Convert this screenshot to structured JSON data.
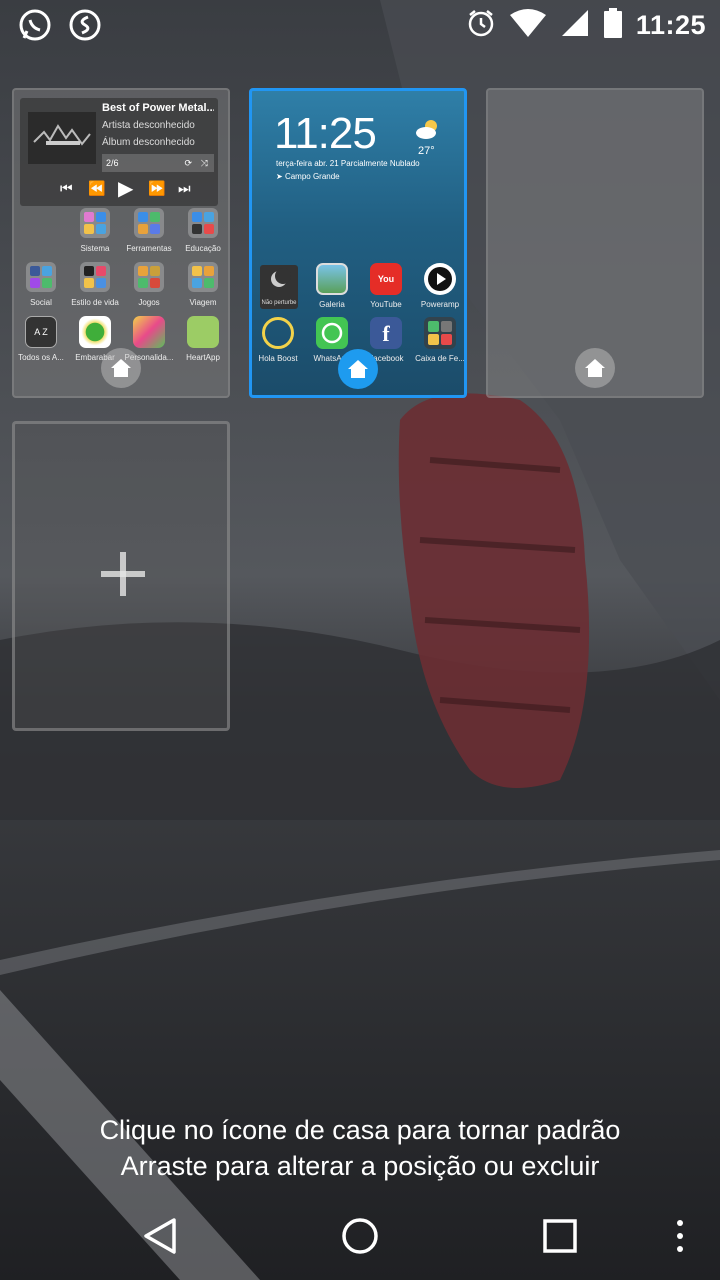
{
  "status_bar": {
    "time": "11:25",
    "left_icons": [
      "whatsapp-icon",
      "shazam-icon"
    ],
    "right_icons": [
      "alarm-icon",
      "wifi-icon",
      "signal-icon",
      "battery-icon"
    ]
  },
  "pages": {
    "left": {
      "music_widget": {
        "title": "Best of Power Metal...",
        "artist": "Artista desconhecido",
        "album": "Álbum desconhecido",
        "track": "2/6"
      },
      "folders_row1": [
        "Sistema",
        "Ferramentas",
        "Educação"
      ],
      "folders_row2": [
        "Social",
        "Estilo de vida",
        "Jogos",
        "Viagem"
      ],
      "apps_row3": [
        "Todos os A...",
        "Embarabar",
        "Personalida...",
        "HeartApp"
      ]
    },
    "center": {
      "clock": "11:25",
      "temperature": "27°",
      "date_weather": "terça-feira abr. 21 Parcialmente Nublado",
      "location": "Campo Grande",
      "apps_row1": [
        "Galeria",
        "YouTube",
        "Poweramp"
      ],
      "widget_small_text": "Não perturbe",
      "apps_row2": [
        "Hola Boost",
        "WhatsApp",
        "Facebook",
        "Caixa de Fe..."
      ]
    }
  },
  "hints": {
    "line1": "Clique no ícone de casa para tornar padrão",
    "line2": "Arraste para alterar a posição ou excluir"
  },
  "navbar": [
    "back-icon",
    "home-icon",
    "recents-icon",
    "more-icon"
  ],
  "colors": {
    "accent": "#2196f3",
    "home_badge": "#1e9bef"
  }
}
